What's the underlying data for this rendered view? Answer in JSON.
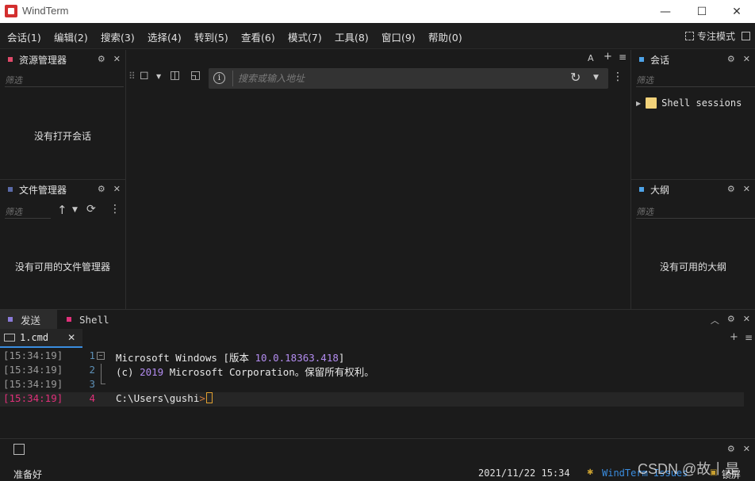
{
  "window": {
    "title": "WindTerm",
    "minimize": "—",
    "maximize": "☐",
    "close": "✕"
  },
  "menu": [
    {
      "label": "会话(1)"
    },
    {
      "label": "编辑(2)"
    },
    {
      "label": "搜索(3)"
    },
    {
      "label": "选择(4)"
    },
    {
      "label": "转到(5)"
    },
    {
      "label": "查看(6)"
    },
    {
      "label": "模式(7)"
    },
    {
      "label": "工具(8)"
    },
    {
      "label": "窗口(9)"
    },
    {
      "label": "帮助(0)"
    }
  ],
  "focus_mode": "专注模式",
  "left_top_panel": {
    "title": "资源管理器",
    "filter_placeholder": "筛选",
    "empty": "没有打开会话",
    "color": "#e04a6a"
  },
  "left_bottom_panel": {
    "title": "文件管理器",
    "filter_placeholder": "筛选",
    "empty": "没有可用的文件管理器",
    "color": "#5a6aa8"
  },
  "right_top_panel": {
    "title": "会话",
    "filter_placeholder": "筛选",
    "tree_item": "Shell sessions",
    "color": "#4ea3e8"
  },
  "right_bottom_panel": {
    "title": "大纲",
    "filter_placeholder": "筛选",
    "empty": "没有可用的大纲",
    "color": "#4ea3e8"
  },
  "center": {
    "address_placeholder": "搜索或输入地址",
    "corner_letter": "A",
    "info_glyph": "i"
  },
  "bottom_tabs": [
    {
      "label": "发送",
      "color": "#8a7ad8",
      "active": true
    },
    {
      "label": "Shell",
      "color": "#e0307a",
      "active": false
    }
  ],
  "terminal_tab": {
    "label": "1.cmd"
  },
  "terminal_lines": [
    {
      "ts": "[15:34:19]",
      "ln": "1",
      "pre": "Microsoft Windows [版本 ",
      "num": "10.0.18363.418",
      "post": "]"
    },
    {
      "ts": "[15:34:19]",
      "ln": "2",
      "pre": "(c) ",
      "num": "2019",
      "post": " Microsoft Corporation。保留所有权利。"
    },
    {
      "ts": "[15:34:19]",
      "ln": "3",
      "pre": "",
      "num": "",
      "post": ""
    },
    {
      "ts": "[15:34:19]",
      "ln": "4",
      "pre": "C:\\Users\\gushi",
      "num": "",
      "post": ">"
    }
  ],
  "status": {
    "ready": "准备好",
    "datetime": "2021/11/22 15:34",
    "issues": "WindTerm Issues",
    "lock": "锁屏",
    "watermark": "CSDN @故丨是"
  },
  "colors": {
    "accent_blue": "#3a8de0",
    "active_line_ts": "#e0307a"
  }
}
